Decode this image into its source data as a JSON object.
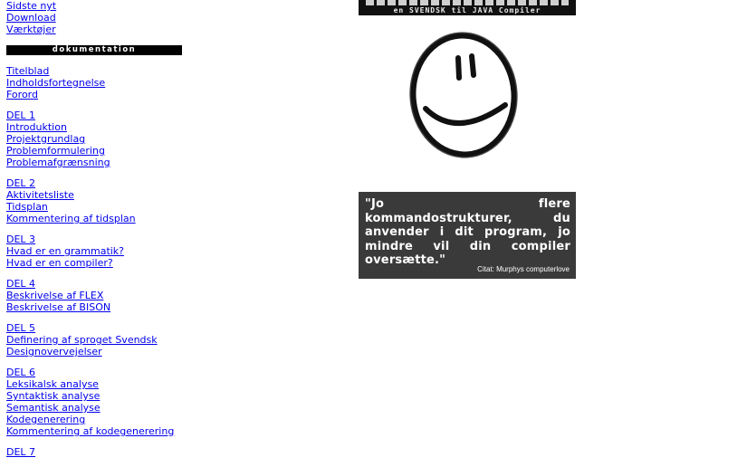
{
  "nav": {
    "top_links": [
      "Sidste nyt",
      "Download",
      "Værktøjer"
    ],
    "section_header": "dokumentation",
    "groups": [
      [
        "Titelblad",
        "Indholdsfortegnelse",
        "Forord"
      ],
      [
        "DEL 1",
        "Introduktion",
        "Projektgrundlag",
        "Problemformulering",
        "Problemafgrænsning"
      ],
      [
        "DEL 2",
        "Aktivitetsliste",
        "Tidsplan",
        "Kommentering af tidsplan"
      ],
      [
        "DEL 3",
        "Hvad er en grammatik?",
        "Hvad er en compiler?"
      ],
      [
        "DEL 4",
        "Beskrivelse af FLEX",
        "Beskrivelse af BISON"
      ],
      [
        "DEL 5",
        "Definering af sproget Svendsk",
        "Designovervejelser"
      ],
      [
        "DEL 6",
        "Leksikalsk analyse",
        "Syntaktisk analyse",
        "Semantisk analyse",
        "Kodegenerering",
        "Kommentering af kodegenerering"
      ],
      [
        "DEL 7"
      ]
    ]
  },
  "banner": {
    "subtitle": "en SVENDSK til JAVA Compiler"
  },
  "quote": {
    "text": "\"Jo flere kommandostrukturer, du anvender i dit program, jo mindre vil din compiler oversætte.\"",
    "citation": "Citat: Murphys computerlove"
  },
  "colors": {
    "link": "#0000ee",
    "section_bar": "#000000",
    "quote_bg": "#3a3a3a"
  }
}
